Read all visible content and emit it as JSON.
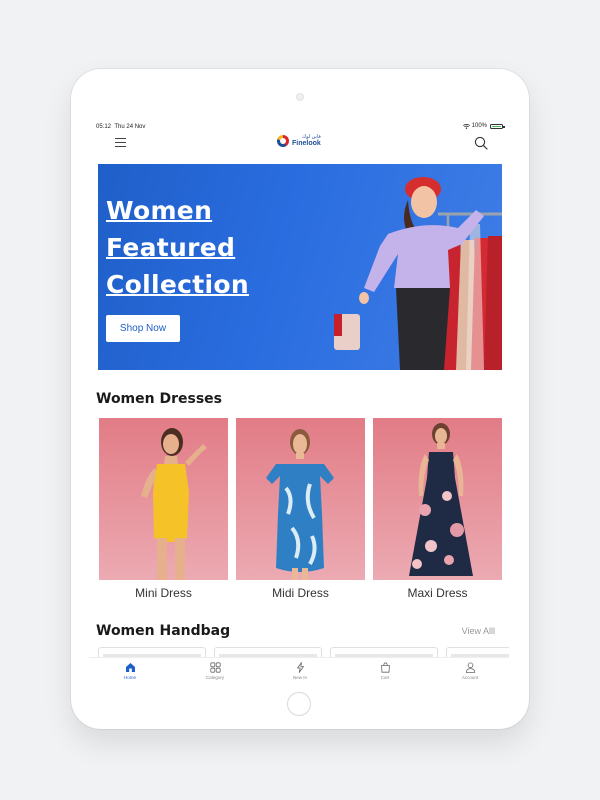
{
  "status_bar": {
    "time": "05:12",
    "date": "Thu 24 Nov",
    "battery": "100%"
  },
  "header": {
    "logo_arabic": "فاين لوك",
    "logo_name": "Finelook"
  },
  "banner": {
    "title_line1": "Women",
    "title_line2": "Featured",
    "title_line3": "Collection",
    "button_label": "Shop Now"
  },
  "dresses": {
    "title": "Women Dresses",
    "items": [
      {
        "label": "Mini Dress",
        "color": "#f5c327"
      },
      {
        "label": "Midi Dress",
        "color": "#2f7fc4"
      },
      {
        "label": "Maxi Dress",
        "color": "#1f2a44"
      }
    ]
  },
  "handbags": {
    "title": "Women Handbag",
    "view_all": "View Alll"
  },
  "tabs": [
    {
      "label": "Home",
      "icon": "home-icon",
      "active": true
    },
    {
      "label": "Category",
      "icon": "category-icon",
      "active": false
    },
    {
      "label": "New In",
      "icon": "lightning-icon",
      "active": false
    },
    {
      "label": "Cart",
      "icon": "shopping-bag-icon",
      "active": false
    },
    {
      "label": "Account",
      "icon": "user-icon",
      "active": false
    }
  ],
  "colors": {
    "accent": "#1f5fc9",
    "banner": "#2a6de0",
    "card_bg": "#e27c86"
  }
}
